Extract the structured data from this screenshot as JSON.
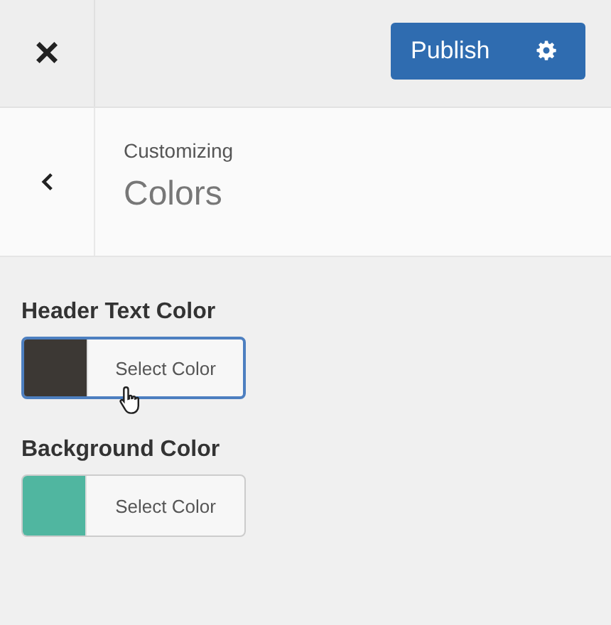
{
  "top_bar": {
    "close_icon": "×",
    "publish_button": "Publish"
  },
  "header": {
    "eyebrow": "Customizing",
    "title": "Colors"
  },
  "controls": [
    {
      "label": "Header Text Color",
      "button": "Select Color",
      "color": "#3c3834",
      "hovered": true
    },
    {
      "label": "Background Color",
      "button": "Select Color",
      "color": "#50b6a0",
      "hovered": false
    }
  ]
}
